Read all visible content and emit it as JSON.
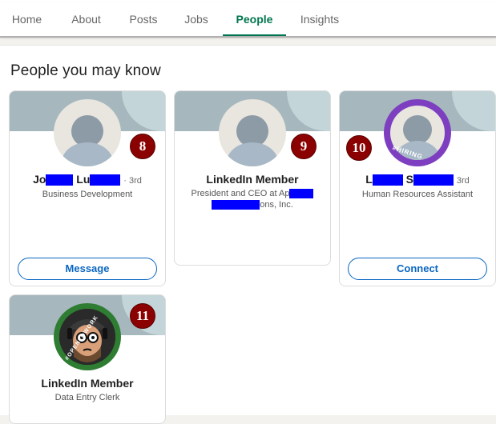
{
  "nav": {
    "tabs": [
      {
        "label": "Home"
      },
      {
        "label": "About"
      },
      {
        "label": "Posts"
      },
      {
        "label": "Jobs"
      },
      {
        "label": "People"
      },
      {
        "label": "Insights"
      }
    ],
    "active_tab": "People"
  },
  "section": {
    "title": "People you may know"
  },
  "cards": [
    {
      "badge": "8",
      "name_visible_start": "Jo",
      "name_visible_mid": "Lu",
      "degree": "· 3rd",
      "headline": "Business Development",
      "button": "Message",
      "avatar_icon": "default-avatar-icon"
    },
    {
      "badge": "9",
      "name": "LinkedIn Member",
      "headline_line1_start": "President and CEO at Ap",
      "headline_line2_end": "ons, Inc.",
      "avatar_icon": "default-avatar-icon"
    },
    {
      "badge": "10",
      "name_visible_start": "L",
      "name_visible_mid": "S",
      "degree": "3rd",
      "headline": "Human Resources Assistant",
      "button": "Connect",
      "avatar_icon": "hiring-avatar-icon",
      "ring_text": "#HIRING"
    },
    {
      "badge": "11",
      "name": "LinkedIn Member",
      "headline": "Data Entry Clerk",
      "avatar_icon": "opentowork-cartoon-avatar-icon",
      "ring_text": "#OPENTOWORK"
    }
  ],
  "colors": {
    "accent_green": "#01754f",
    "link_blue": "#0a66c2",
    "badge_red": "#8b0000",
    "redaction_blue": "#0000ff",
    "hiring_purple": "#7d3fc0",
    "opentowork_green": "#2e7d32"
  }
}
